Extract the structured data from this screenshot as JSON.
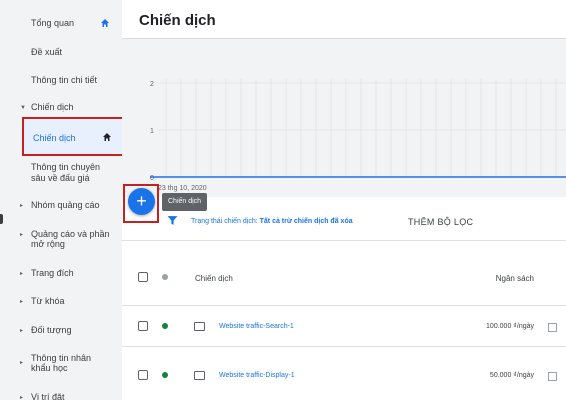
{
  "sidebar": {
    "items": [
      {
        "label": "Tổng quan"
      },
      {
        "label": "Đề xuất"
      },
      {
        "label": "Thông tin chi tiết"
      },
      {
        "label": "Chiến dịch"
      },
      {
        "label": "Chiến dịch"
      },
      {
        "label": "Thông tin chuyên",
        "label2": "sâu về đấu giá"
      },
      {
        "label": "Nhóm quảng cáo"
      },
      {
        "label": "Quảng cáo và phần",
        "label2": "mở rộng"
      },
      {
        "label": "Trang đích"
      },
      {
        "label": "Từ khóa"
      },
      {
        "label": "Đối tượng"
      },
      {
        "label": "Thông tin nhân",
        "label2": "khẩu học"
      },
      {
        "label": "Vị trí đặt"
      }
    ]
  },
  "main": {
    "title": "Chiến dịch",
    "chart": {
      "y_ticks": [
        "2",
        "1",
        "0"
      ],
      "x_start_label": "23 thg 10, 2020"
    },
    "fab_icon": "+",
    "tooltip": "Chiến dịch",
    "filter": {
      "prefix": "Trạng thái chiến dịch:",
      "value": "Tất cả trừ chiến dịch đã xóa",
      "add_label": "THÊM BỘ LỌC"
    },
    "table": {
      "headers": {
        "campaign": "Chiến dịch",
        "budget": "Ngân sách"
      },
      "rows": [
        {
          "name": "Website traffic-Search-1",
          "budget": "100.000 ₫/ngày",
          "status_color": "#188038",
          "icon": "search-campaign-icon"
        },
        {
          "name": "Website traffic-Display-1",
          "budget": "50.000 ₫/ngày",
          "status_color": "#188038",
          "icon": "display-campaign-icon"
        }
      ]
    }
  },
  "colors": {
    "accent": "#1a73e8",
    "highlight_border": "#c5221f",
    "status_enabled": "#188038"
  },
  "chart_data": {
    "type": "line",
    "x": [
      "23 thg 10, 2020"
    ],
    "series": [
      {
        "values": [
          0
        ]
      }
    ],
    "ylim": [
      0,
      2
    ],
    "yticks": [
      0,
      1,
      2
    ],
    "grid": true
  }
}
